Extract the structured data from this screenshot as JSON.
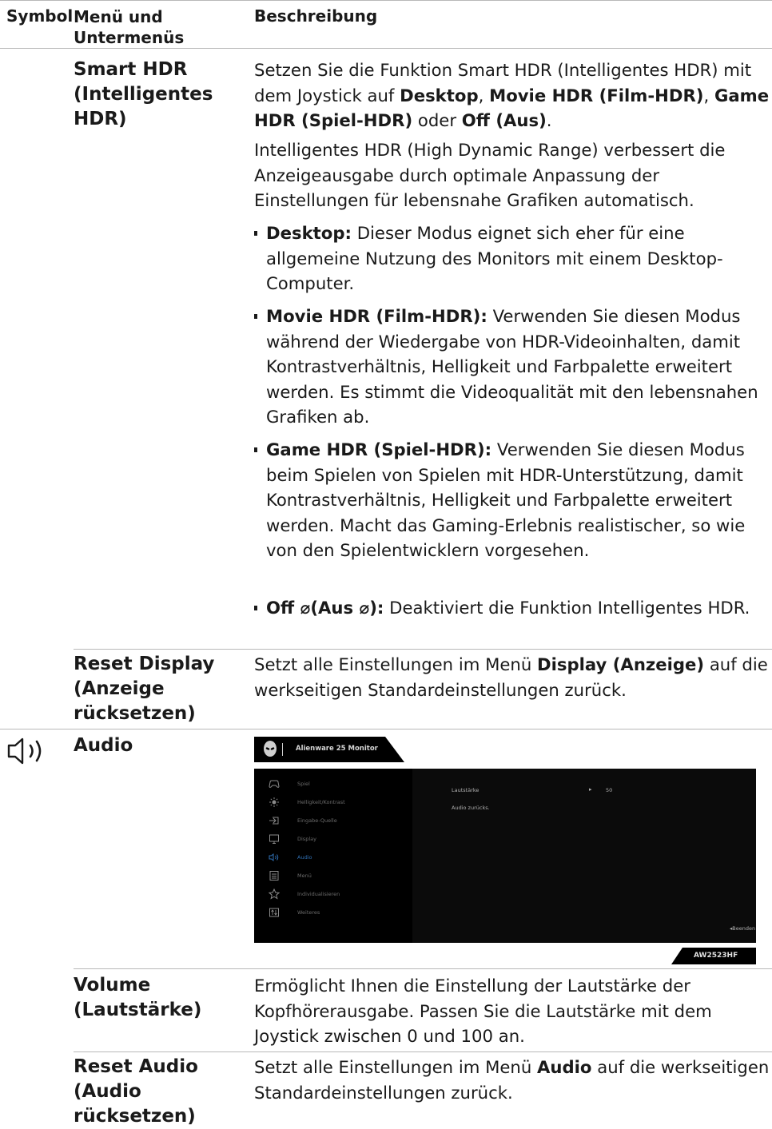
{
  "header": {
    "col_symbol": "Symbol",
    "col_menu": "Menü und Untermenüs",
    "col_desc": "Beschreibung"
  },
  "smart_hdr": {
    "name": "Smart HDR (Intelligentes HDR)",
    "p1_a": "Setzen Sie die Funktion Smart HDR (Intelligentes HDR) mit dem Joystick auf ",
    "p1_b": "Desktop",
    "p1_c": ", ",
    "p1_d": "Movie HDR (Film-HDR)",
    "p1_e": ", ",
    "p1_f": "Game HDR (Spiel-HDR)",
    "p1_g": " oder ",
    "p1_h": "Off (Aus)",
    "p1_i": ".",
    "p2": "Intelligentes HDR (High Dynamic Range) verbessert die Anzeigeausgabe durch optimale Anpassung der Einstellungen für lebensnahe Grafiken automatisch.",
    "b1_title": "Desktop:",
    "b1_text": " Dieser Modus eignet sich eher für eine allgemeine Nutzung des Monitors mit einem Desktop-Computer.",
    "b2_title": "Movie HDR (Film-HDR):",
    "b2_text": " Verwenden Sie diesen Modus während der Wiedergabe von HDR-Videoinhalten, damit Kontrastverhältnis, Helligkeit und Farbpalette erweitert werden. Es stimmt die Videoqualität mit den lebensnahen Grafiken ab.",
    "b3_title": "Game HDR (Spiel-HDR):",
    "b3_text": " Verwenden Sie diesen Modus beim Spielen von Spielen mit HDR-Unterstützung, damit Kontrastverhältnis, Helligkeit und Farbpalette erweitert werden. Macht das Gaming-Erlebnis realistischer, so wie von den Spielentwicklern vorgesehen.",
    "b4_title_a": "Off ",
    "b4_sym": "⌀",
    "b4_title_b": "(Aus ",
    "b4_title_c": "):",
    "b4_text": " Deaktiviert die Funktion Intelligentes HDR."
  },
  "reset_display": {
    "name": "Reset Display (Anzeige rücksetzen)",
    "text_a": "Setzt alle Einstellungen im Menü ",
    "text_b": "Display (Anzeige)",
    "text_c": " auf die werkseitigen Standardeinstellungen zurück."
  },
  "audio": {
    "name": "Audio",
    "icon": "speaker-icon"
  },
  "osd": {
    "title": "Alienware 25 Monitor",
    "model": "AW2523HF",
    "menu": [
      {
        "label": "Spiel",
        "icon": "gamepad-icon"
      },
      {
        "label": "Helligkeit/Kontrast",
        "icon": "sun-icon"
      },
      {
        "label": "Eingabe-Quelle",
        "icon": "input-icon"
      },
      {
        "label": "Display",
        "icon": "monitor-icon"
      },
      {
        "label": "Audio",
        "icon": "speaker-icon"
      },
      {
        "label": "Menü",
        "icon": "list-icon"
      },
      {
        "label": "Individualisieren",
        "icon": "star-icon"
      },
      {
        "label": "Weiteres",
        "icon": "other-icon"
      }
    ],
    "active_index": 4,
    "rows": [
      {
        "label": "Lautstärke",
        "value": "50"
      },
      {
        "label": "Audio zurücks.",
        "value": ""
      }
    ],
    "exit_label": "Beenden"
  },
  "volume": {
    "name": "Volume (Lautstärke)",
    "text": "Ermöglicht Ihnen die Einstellung der Lautstärke der Kopfhörerausgabe. Passen Sie die Lautstärke mit dem Joystick zwischen 0 und 100 an."
  },
  "reset_audio": {
    "name": "Reset Audio (Audio rücksetzen)",
    "text_a": "Setzt alle Einstellungen im Menü ",
    "text_b": "Audio",
    "text_c": " auf die werkseitigen Standardeinstellungen zurück."
  }
}
